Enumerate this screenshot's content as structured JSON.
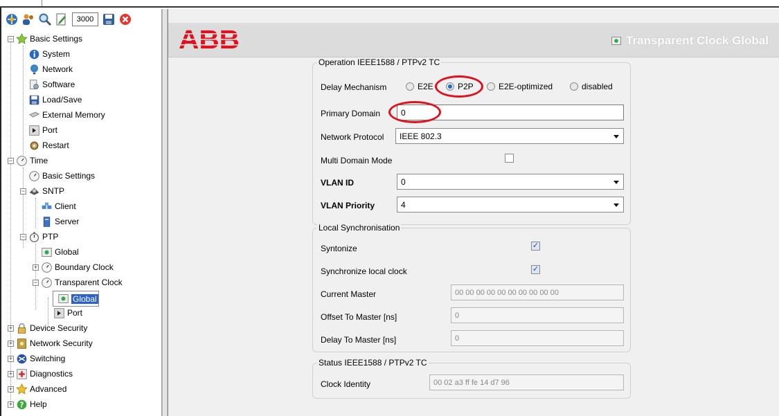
{
  "toolbar": {
    "poll_interval": "3000",
    "icons": [
      "network-icon",
      "users-icon",
      "search-icon",
      "edit-icon",
      "save-icon",
      "close-icon"
    ]
  },
  "tree": {
    "basic_settings": "Basic Settings",
    "system": "System",
    "network": "Network",
    "software": "Software",
    "load_save": "Load/Save",
    "external_memory": "External Memory",
    "port": "Port",
    "restart": "Restart",
    "time": "Time",
    "time_basic_settings": "Basic Settings",
    "sntp": "SNTP",
    "client": "Client",
    "server": "Server",
    "ptp": "PTP",
    "ptp_global": "Global",
    "boundary_clock": "Boundary Clock",
    "transparent_clock": "Transparent Clock",
    "tc_global": "Global",
    "tc_port": "Port",
    "device_security": "Device Security",
    "network_security": "Network Security",
    "switching": "Switching",
    "diagnostics": "Diagnostics",
    "advanced": "Advanced",
    "help": "Help"
  },
  "header": {
    "logo": "ABB",
    "title": "Transparent Clock Global"
  },
  "operation": {
    "title": "Operation IEEE1588 / PTPv2 TC",
    "delay_mechanism_label": "Delay Mechanism",
    "delay_options": [
      "E2E",
      "P2P",
      "E2E-optimized",
      "disabled"
    ],
    "delay_selected": "P2P",
    "primary_domain_label": "Primary Domain",
    "primary_domain_value": "0",
    "network_protocol_label": "Network Protocol",
    "network_protocol_value": "IEEE 802.3",
    "multi_domain_label": "Multi Domain Mode",
    "multi_domain_checked": false,
    "vlan_id_label": "VLAN ID",
    "vlan_id_value": "0",
    "vlan_priority_label": "VLAN Priority",
    "vlan_priority_value": "4"
  },
  "local_sync": {
    "title": "Local Synchronisation",
    "syntonize_label": "Syntonize",
    "syntonize_checked": true,
    "sync_local_label": "Synchronize local clock",
    "sync_local_checked": true,
    "current_master_label": "Current Master",
    "current_master_value": "00 00 00 00 00 00 00 00 00 00",
    "offset_label": "Offset To Master [ns]",
    "offset_value": "0",
    "delay_label": "Delay To Master [ns]",
    "delay_value": "0"
  },
  "status": {
    "title": "Status IEEE1588 / PTPv2 TC",
    "clock_identity_label": "Clock Identity",
    "clock_identity_value": "00 02 a3 ff fe 14 d7 96"
  },
  "colors": {
    "selection": "#2a62c9",
    "annotation_ring": "#e0101c",
    "abb_red": "#e0101c",
    "radio_selected": "#1d6ac8"
  }
}
